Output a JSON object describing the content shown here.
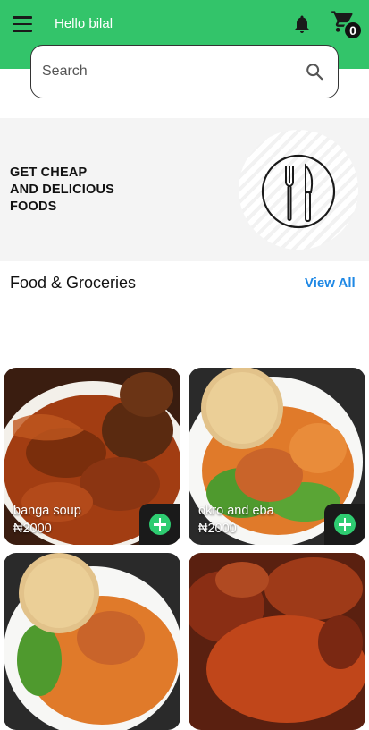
{
  "header": {
    "greeting": "Hello bilal",
    "cart_count": "0",
    "background_color": "#33c46a"
  },
  "search": {
    "placeholder": "Search"
  },
  "banner": {
    "line1": "GET CHEAP",
    "line2": "AND DELICIOUS",
    "line3": "FOODS",
    "icon": "cutlery-icon"
  },
  "section": {
    "title": "Food & Groceries",
    "view_all": "View All",
    "link_color": "#1e88e5"
  },
  "products": [
    {
      "name": "banga soup",
      "price": "₦2000"
    },
    {
      "name": "okro and eba",
      "price": "₦2000"
    },
    {
      "name": "",
      "price": ""
    },
    {
      "name": "",
      "price": ""
    }
  ],
  "icons": {
    "menu": "hamburger-menu-icon",
    "notifications": "bell-icon",
    "cart": "cart-icon",
    "search": "search-icon",
    "add": "plus-circle-icon"
  }
}
